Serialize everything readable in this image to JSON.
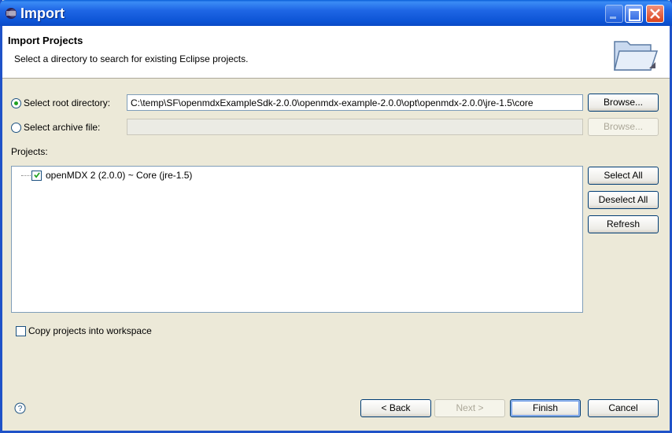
{
  "window": {
    "title": "Import"
  },
  "header": {
    "title": "Import Projects",
    "description": "Select a directory to search for existing Eclipse projects."
  },
  "source": {
    "root_label": "Select root directory:",
    "root_selected": true,
    "root_path": "C:\\temp\\SF\\openmdxExampleSdk-2.0.0\\openmdx-example-2.0.0\\opt\\openmdx-2.0.0\\jre-1.5\\core",
    "archive_label": "Select archive file:",
    "archive_path": "",
    "browse_label": "Browse..."
  },
  "projects": {
    "label": "Projects:",
    "items": [
      {
        "label": "openMDX 2 (2.0.0) ~ Core (jre-1.5)",
        "checked": true
      }
    ],
    "select_all": "Select All",
    "deselect_all": "Deselect All",
    "refresh": "Refresh"
  },
  "options": {
    "copy_label": "Copy projects into workspace",
    "copy_checked": false
  },
  "footer": {
    "back": "< Back",
    "next": "Next >",
    "finish": "Finish",
    "cancel": "Cancel"
  }
}
